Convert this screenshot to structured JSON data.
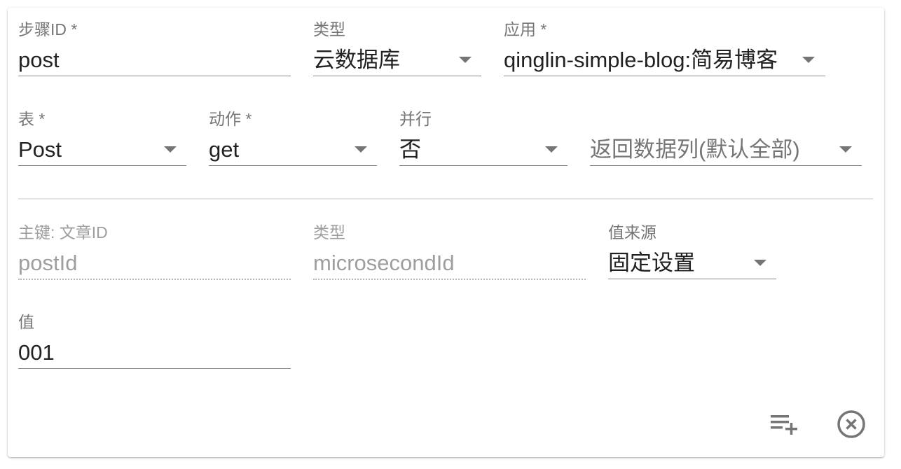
{
  "step": {
    "step_id": {
      "label": "步骤ID *",
      "value": "post"
    },
    "type": {
      "label": "类型",
      "value": "云数据库"
    },
    "app": {
      "label": "应用 *",
      "value": "qinglin-simple-blog:简易博客"
    }
  },
  "query": {
    "table": {
      "label": "表 *",
      "value": "Post"
    },
    "action": {
      "label": "动作 *",
      "value": "get"
    },
    "parallel": {
      "label": "并行",
      "value": "否"
    },
    "columns": {
      "placeholder": "返回数据列(默认全部)"
    }
  },
  "key": {
    "primary_key": {
      "label": "主键: 文章ID",
      "value": "postId"
    },
    "type": {
      "label": "类型",
      "value": "microsecondId"
    },
    "value_source": {
      "label": "值来源",
      "value": "固定设置"
    },
    "value": {
      "label": "值",
      "value": "001"
    }
  },
  "actions": {
    "add_icon": "playlist-add-icon",
    "remove_icon": "close-circle-icon"
  }
}
